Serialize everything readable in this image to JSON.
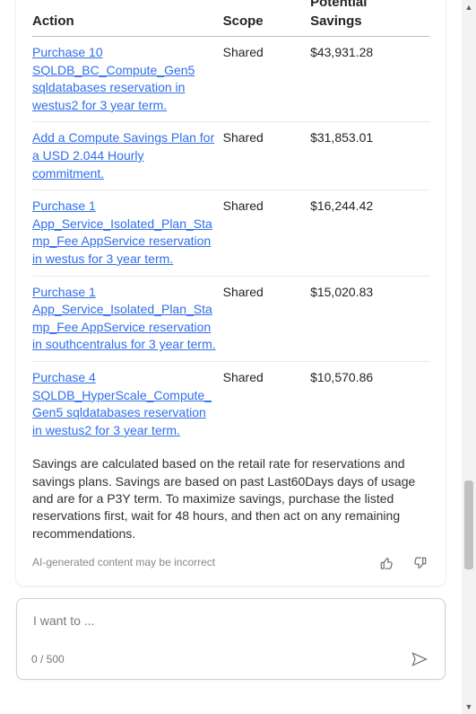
{
  "table": {
    "headers": {
      "action": "Action",
      "scope": "Scope",
      "savings_line1": "Potential",
      "savings_line2": "Savings"
    },
    "rows": [
      {
        "action": "Purchase 10 SQLDB_BC_Compute_Gen5 sqldatabases reservation in westus2 for 3 year term.",
        "scope": "Shared",
        "savings": "$43,931.28"
      },
      {
        "action": "Add a Compute Savings Plan for a USD 2.044 Hourly commitment.",
        "scope": "Shared",
        "savings": "$31,853.01"
      },
      {
        "action": "Purchase 1 App_Service_Isolated_Plan_Stamp_Fee AppService reservation in westus for 3 year term.",
        "scope": "Shared",
        "savings": "$16,244.42"
      },
      {
        "action": "Purchase 1 App_Service_Isolated_Plan_Stamp_Fee AppService reservation in southcentralus for 3 year term.",
        "scope": "Shared",
        "savings": "$15,020.83"
      },
      {
        "action": "Purchase 4 SQLDB_HyperScale_Compute_Gen5 sqldatabases reservation in westus2 for 3 year term.",
        "scope": "Shared",
        "savings": "$10,570.86"
      }
    ]
  },
  "explanation": "Savings are calculated based on the retail rate for reservations and savings plans. Savings are based on past Last60Days days of usage and are for a P3Y term. To maximize savings, purchase the listed reservations first, wait for 48 hours, and then act on any remaining recommendations.",
  "ai_note": "AI-generated content may be incorrect",
  "input": {
    "placeholder": "I want to ...",
    "counter": "0 / 500"
  }
}
